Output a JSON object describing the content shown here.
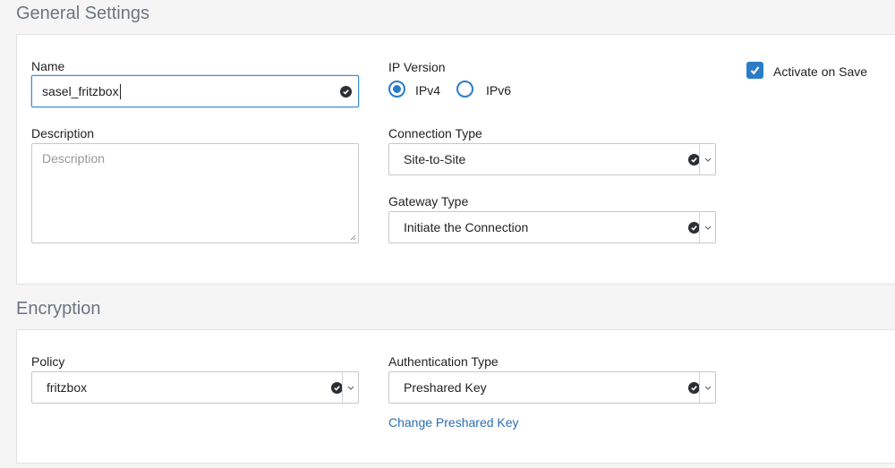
{
  "general": {
    "title": "General Settings",
    "name_label": "Name",
    "name_value": "sasel_fritzbox",
    "description_label": "Description",
    "description_placeholder": "Description",
    "ip_version_label": "IP Version",
    "ipv4_label": "IPv4",
    "ipv6_label": "IPv6",
    "ip_version_selected": "IPv4",
    "connection_type_label": "Connection Type",
    "connection_type_value": "Site-to-Site",
    "gateway_type_label": "Gateway Type",
    "gateway_type_value": "Initiate the Connection",
    "activate_label": "Activate on Save",
    "activate_checked": true
  },
  "encryption": {
    "title": "Encryption",
    "policy_label": "Policy",
    "policy_value": "fritzbox",
    "auth_type_label": "Authentication Type",
    "auth_type_value": "Preshared Key",
    "change_key_link": "Change Preshared Key"
  },
  "colors": {
    "accent": "#2a7cc7",
    "focus_border": "#3a8ed6",
    "link": "#2a6eb3",
    "section_title": "#6b7580"
  },
  "icons": {
    "valid": "check-circle-icon",
    "dropdown": "chevron-down-icon",
    "checkbox": "checkmark-icon"
  }
}
